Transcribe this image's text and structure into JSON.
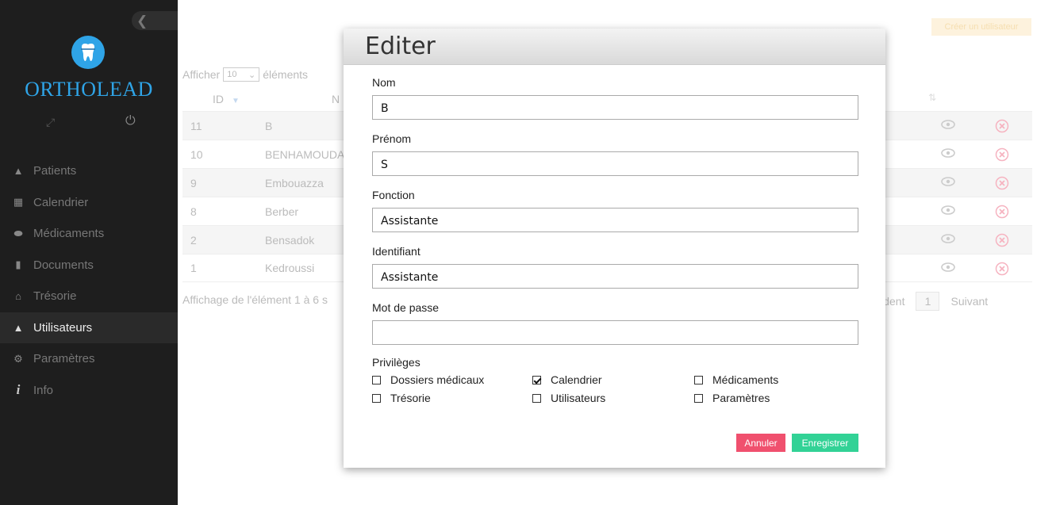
{
  "sidebar": {
    "brand": "ORTHOLEAD",
    "items": [
      {
        "label": "Patients",
        "icon": "user-group-icon"
      },
      {
        "label": "Calendrier",
        "icon": "calendar-icon"
      },
      {
        "label": "Médicaments",
        "icon": "pill-icon"
      },
      {
        "label": "Documents",
        "icon": "document-icon"
      },
      {
        "label": "Trésorie",
        "icon": "home-icon"
      },
      {
        "label": "Utilisateurs",
        "icon": "user-icon"
      },
      {
        "label": "Paramètres",
        "icon": "settings-icon"
      },
      {
        "label": "Info",
        "icon": "info-icon"
      }
    ],
    "active": "Utilisateurs"
  },
  "main": {
    "create_button": "Créer un utilisateur",
    "show_prefix": "Afficher",
    "show_value": "10",
    "show_suffix": "éléments",
    "columns": {
      "id": "ID",
      "name": "N"
    },
    "rows": [
      {
        "id": "11",
        "name": "B"
      },
      {
        "id": "10",
        "name": "BENHAMOUDA"
      },
      {
        "id": "9",
        "name": "Embouazza"
      },
      {
        "id": "8",
        "name": "Berber"
      },
      {
        "id": "2",
        "name": "Bensadok"
      },
      {
        "id": "1",
        "name": "Kedroussi"
      }
    ],
    "info": "Affichage de l'élément 1 à 6 s",
    "pager": {
      "prev": "récédent",
      "page": "1",
      "next": "Suivant"
    }
  },
  "modal": {
    "title": "Editer",
    "fields": {
      "nom": {
        "label": "Nom",
        "value": "B"
      },
      "prenom": {
        "label": "Prénom",
        "value": "S"
      },
      "fonction": {
        "label": "Fonction",
        "value": "Assistante"
      },
      "identifiant": {
        "label": "Identifiant",
        "value": "Assistante"
      },
      "password": {
        "label": "Mot de passe",
        "value": ""
      }
    },
    "privileges_label": "Privilèges",
    "privileges": [
      {
        "label": "Dossiers médicaux",
        "checked": false
      },
      {
        "label": "Calendrier",
        "checked": true
      },
      {
        "label": "Médicaments",
        "checked": false
      },
      {
        "label": "Trésorie",
        "checked": false
      },
      {
        "label": "Utilisateurs",
        "checked": false
      },
      {
        "label": "Paramètres",
        "checked": false
      }
    ],
    "cancel": "Annuler",
    "save": "Enregistrer"
  },
  "colors": {
    "sidebar_bg": "#1e1e1e",
    "brand": "#2fa4e7",
    "cancel": "#f0506e",
    "save": "#32d296"
  }
}
